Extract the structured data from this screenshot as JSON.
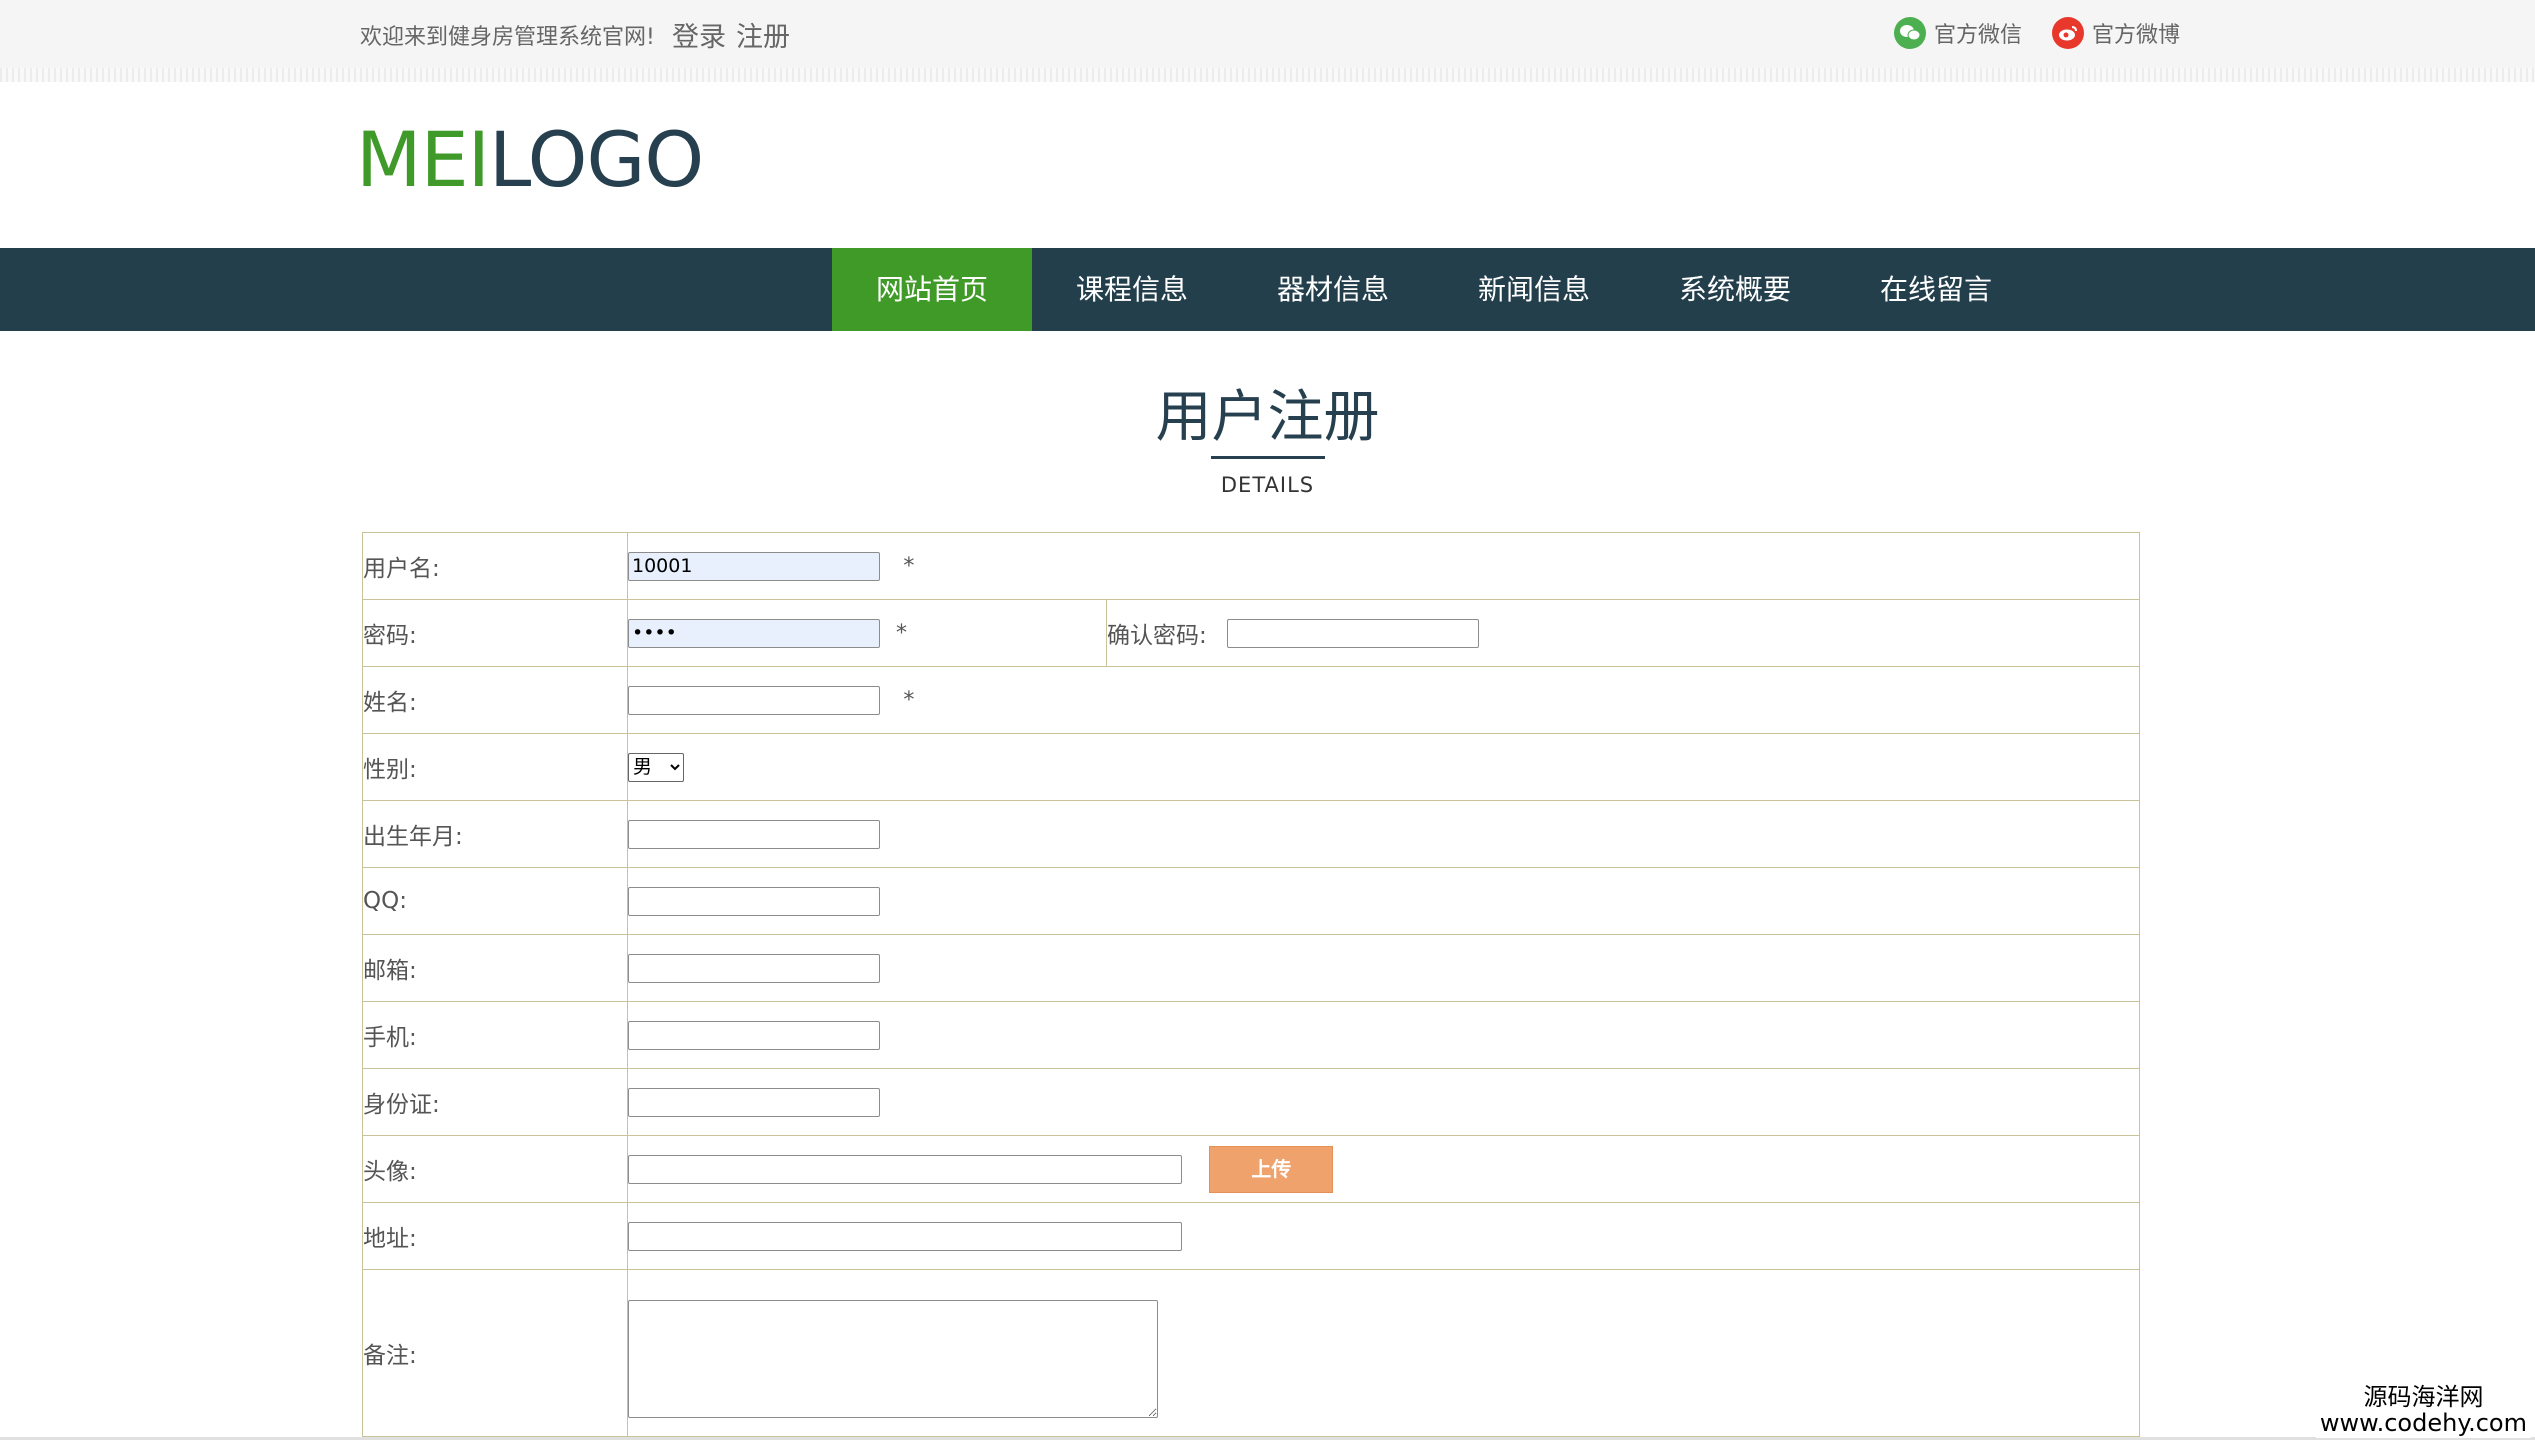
{
  "topbar": {
    "welcome": "欢迎来到健身房管理系统官网!",
    "login": "登录",
    "register": "注册",
    "wechat": "官方微信",
    "weibo": "官方微博"
  },
  "logo": {
    "part1": "MEI",
    "part2": "LOGO"
  },
  "nav": {
    "items": [
      {
        "label": "网站首页"
      },
      {
        "label": "课程信息"
      },
      {
        "label": "器材信息"
      },
      {
        "label": "新闻信息"
      },
      {
        "label": "系统概要"
      },
      {
        "label": "在线留言"
      }
    ]
  },
  "heading": {
    "title": "用户注册",
    "subtitle": "DETAILS"
  },
  "form": {
    "username": {
      "label": "用户名:",
      "value": "10001",
      "required": "*"
    },
    "password": {
      "label": "密码:",
      "value": "••••",
      "required": "*",
      "confirm_label": "确认密码:",
      "confirm_value": ""
    },
    "name": {
      "label": "姓名:",
      "value": "",
      "required": "*"
    },
    "gender": {
      "label": "性别:",
      "selected": "男"
    },
    "birth": {
      "label": "出生年月:",
      "value": ""
    },
    "qq": {
      "label": "QQ:",
      "value": ""
    },
    "email": {
      "label": "邮箱:",
      "value": ""
    },
    "phone": {
      "label": "手机:",
      "value": ""
    },
    "idcard": {
      "label": "身份证:",
      "value": ""
    },
    "avatar": {
      "label": "头像:",
      "value": "",
      "upload": "上传"
    },
    "address": {
      "label": "地址:",
      "value": ""
    },
    "remark": {
      "label": "备注:",
      "value": ""
    }
  },
  "watermark": {
    "line1": "源码海洋网",
    "line2": "www.codehy.com"
  }
}
